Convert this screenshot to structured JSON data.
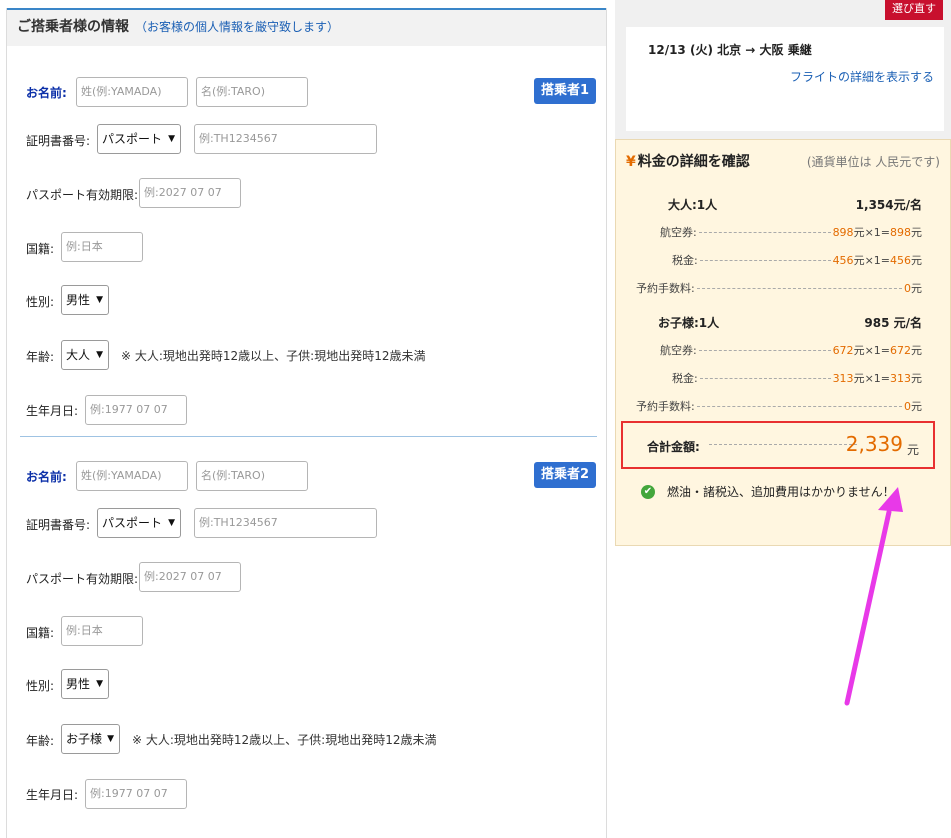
{
  "form": {
    "title": "ご搭乗者様の情報",
    "note": "（お客様の個人情報を厳守致します）",
    "passengers": [
      {
        "badge": "搭乗者1",
        "name_label": "お名前:",
        "surname_placeholder": "姓(例:YAMADA)",
        "given_placeholder": "名(例:TARO)",
        "id_label": "証明書番号:",
        "id_type": "パスポート",
        "id_placeholder": "例:TH1234567",
        "expiry_label": "パスポート有効期限:",
        "expiry_placeholder": "例:2027 07 07",
        "nationality_label": "国籍:",
        "nationality_placeholder": "例:日本",
        "gender_label": "性別:",
        "gender": "男性",
        "age_label": "年齢:",
        "age": "大人",
        "age_note": "※ 大人:現地出発時12歳以上、子供:現地出発時12歳未満",
        "dob_label": "生年月日:",
        "dob_placeholder": "例:1977 07 07"
      },
      {
        "badge": "搭乗者2",
        "name_label": "お名前:",
        "surname_placeholder": "姓(例:YAMADA)",
        "given_placeholder": "名(例:TARO)",
        "id_label": "証明書番号:",
        "id_type": "パスポート",
        "id_placeholder": "例:TH1234567",
        "expiry_label": "パスポート有効期限:",
        "expiry_placeholder": "例:2027 07 07",
        "nationality_label": "国籍:",
        "nationality_placeholder": "例:日本",
        "gender_label": "性別:",
        "gender": "男性",
        "age_label": "年齢:",
        "age": "お子様",
        "age_note": "※ 大人:現地出発時12歳以上、子供:現地出発時12歳未満",
        "dob_label": "生年月日:",
        "dob_placeholder": "例:1977 07 07"
      }
    ]
  },
  "flight": {
    "reselect_label": "選び直す",
    "summary": "12/13 (火)  北京 → 大阪  乗継",
    "detail_link": "フライトの詳細を表示する"
  },
  "fare": {
    "header": "料金の詳細を確認",
    "currency_note": "(通貨単位は 人民元です)",
    "adult": {
      "title": "大人:1人",
      "per_person": "1,354元/名",
      "ticket_label": "航空券:",
      "ticket_value": "898",
      "ticket_total": "898",
      "tax_label": "税金:",
      "tax_value": "456",
      "tax_total": "456",
      "fee_label": "予約手数料:",
      "fee_value": "0"
    },
    "child": {
      "title": "お子様:1人",
      "per_person": "985 元/名",
      "ticket_label": "航空券:",
      "ticket_value": "672",
      "ticket_total": "672",
      "tax_label": "税金:",
      "tax_value": "313",
      "tax_total": "313",
      "fee_label": "予約手数料:",
      "fee_value": "0"
    },
    "unit": "元",
    "times": "×",
    "count": "1",
    "total_label": "合計金額:",
    "total_amount": "2,339",
    "notice": "燃油・諸税込、追加費用はかかりません！"
  },
  "colors": {
    "accent_orange": "#e36b00",
    "highlight_red": "#e83030",
    "annotation_magenta": "#e839e8",
    "badge_blue": "#2f6fd0"
  }
}
